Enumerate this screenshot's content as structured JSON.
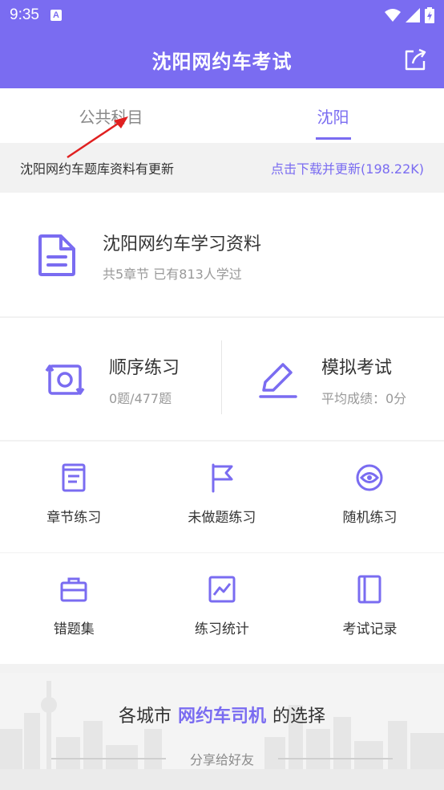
{
  "status_bar": {
    "time": "9:35"
  },
  "header": {
    "title": "沈阳网约车考试"
  },
  "tabs": [
    {
      "label": "公共科目",
      "active": false
    },
    {
      "label": "沈阳",
      "active": true
    }
  ],
  "notice": {
    "text": "沈阳网约车题库资料有更新",
    "action": "点击下载并更新(198.22K)"
  },
  "study_card": {
    "title": "沈阳网约车学习资料",
    "subtitle": "共5章节  已有813人学过"
  },
  "practice": {
    "sequential": {
      "title": "顺序练习",
      "subtitle": "0题/477题"
    },
    "mock_exam": {
      "title": "模拟考试",
      "subtitle": "平均成绩：0分"
    }
  },
  "grid": [
    {
      "label": "章节练习",
      "icon": "book-icon"
    },
    {
      "label": "未做题练习",
      "icon": "flag-icon"
    },
    {
      "label": "随机练习",
      "icon": "shuffle-icon"
    },
    {
      "label": "错题集",
      "icon": "briefcase-icon"
    },
    {
      "label": "练习统计",
      "icon": "chart-icon"
    },
    {
      "label": "考试记录",
      "icon": "notebook-icon"
    }
  ],
  "footer": {
    "slogan_prefix": "各城市",
    "slogan_highlight": "网约车司机",
    "slogan_suffix": "的选择",
    "share": "分享给好友"
  },
  "colors": {
    "accent": "#7a6cf1",
    "annotation_arrow": "#e02020"
  }
}
